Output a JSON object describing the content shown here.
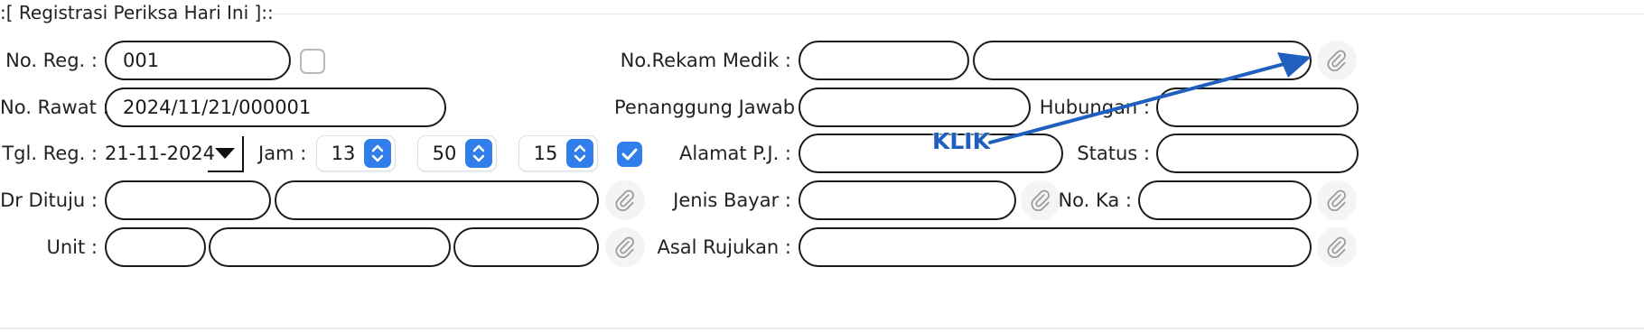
{
  "form": {
    "legend": ":[ Registrasi Periksa Hari Ini ]::"
  },
  "left": {
    "no_reg": {
      "label": "No. Reg. :",
      "value": "001"
    },
    "no_rawat": {
      "label": "No. Rawat :",
      "value": "2024/11/21/000001"
    },
    "tgl_reg": {
      "label": "Tgl. Reg. :",
      "value": "21-11-2024"
    },
    "jam": {
      "label": "Jam :",
      "hour": "13",
      "minute": "50",
      "second": "15"
    },
    "dr_dituju": {
      "label": "Dr Dituju :",
      "code": "",
      "name": ""
    },
    "unit": {
      "label": "Unit :",
      "code": "",
      "name": "",
      "extra": ""
    }
  },
  "right": {
    "no_rekam_medik": {
      "label": "No.Rekam Medik :",
      "code": "",
      "name": ""
    },
    "penanggung_jawab": {
      "label": "Penanggung Jawab :",
      "value": ""
    },
    "hubungan": {
      "label": "Hubungan :",
      "value": ""
    },
    "alamat_pj": {
      "label": "Alamat P.J. :",
      "value": ""
    },
    "status": {
      "label": "Status :",
      "value": ""
    },
    "jenis_bayar": {
      "label": "Jenis Bayar :",
      "value": ""
    },
    "no_ka": {
      "label": "No. Ka :",
      "value": ""
    },
    "asal_rujukan": {
      "label": "Asal Rujukan :",
      "value": ""
    }
  },
  "annotation": {
    "text": "KLIK",
    "color": "#1f5fbf"
  },
  "colors": {
    "accent": "#2f7ee9",
    "border": "#1a1a1a"
  },
  "icons": {
    "lookup": "paperclip-icon",
    "dropdown": "triangle-down-icon",
    "spinner": "up-down-chevron-icon",
    "check": "checkmark-icon"
  }
}
